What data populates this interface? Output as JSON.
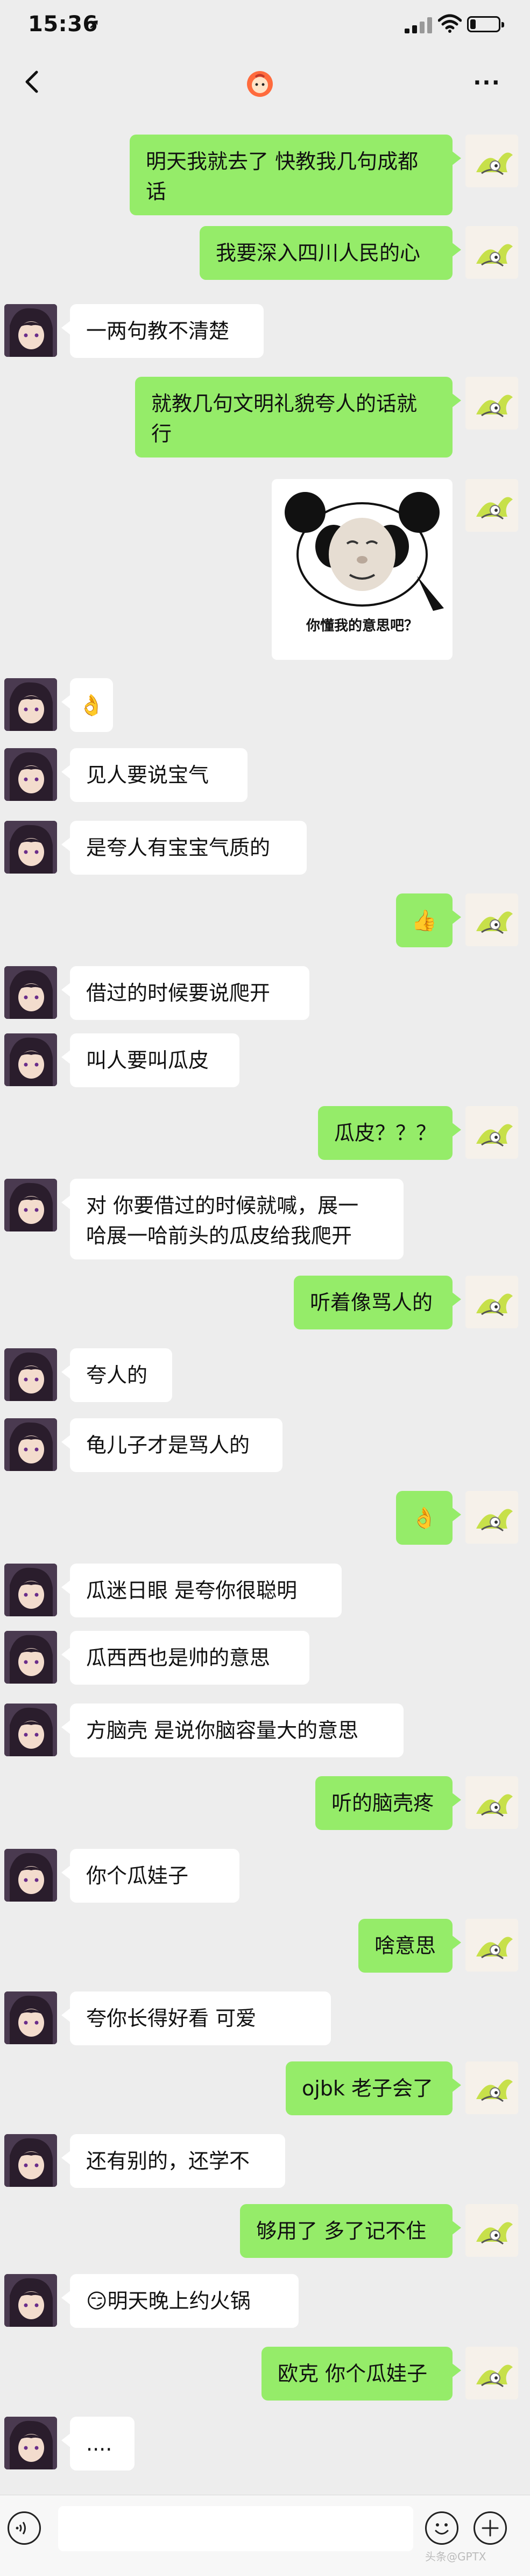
{
  "status_bar": {
    "time": "15:36",
    "location_icon": "location-arrow-icon",
    "signal_icon": "signal-bars-icon",
    "wifi_icon": "wifi-icon",
    "battery_icon": "battery-icon",
    "battery_level": 0.2
  },
  "nav": {
    "back_icon": "chevron-left-icon",
    "title_avatar_icon": "contact-avatar-icon",
    "more_label": "···"
  },
  "messages": [
    {
      "side": "me",
      "type": "text",
      "text": "明天我就去了 快教我几句成都\n话"
    },
    {
      "side": "me",
      "type": "text",
      "text": "我要深入四川人民的心"
    },
    {
      "side": "them",
      "type": "text",
      "text": "一两句教不清楚"
    },
    {
      "side": "me",
      "type": "text",
      "text": "就教几句文明礼貌夸人的话就\n行"
    },
    {
      "side": "me",
      "type": "sticker",
      "text": "你懂我的意思吧？"
    },
    {
      "side": "them",
      "type": "emoji",
      "text": "👌"
    },
    {
      "side": "them",
      "type": "text",
      "text": "见人要说宝气"
    },
    {
      "side": "them",
      "type": "text",
      "text": "是夸人有宝宝气质的"
    },
    {
      "side": "me",
      "type": "emoji",
      "text": "👍"
    },
    {
      "side": "them",
      "type": "text",
      "text": "借过的时候要说爬开"
    },
    {
      "side": "them",
      "type": "text",
      "text": "叫人要叫瓜皮"
    },
    {
      "side": "me",
      "type": "text",
      "text": "瓜皮？？？"
    },
    {
      "side": "them",
      "type": "text",
      "text": "对 你要借过的时候就喊，展一\n哈展一哈前头的瓜皮给我爬开"
    },
    {
      "side": "me",
      "type": "text",
      "text": "听着像骂人的"
    },
    {
      "side": "them",
      "type": "text",
      "text": "夸人的"
    },
    {
      "side": "them",
      "type": "text",
      "text": "龟儿子才是骂人的"
    },
    {
      "side": "me",
      "type": "emoji",
      "text": "👌"
    },
    {
      "side": "them",
      "type": "text",
      "text": "瓜迷日眼 是夸你很聪明"
    },
    {
      "side": "them",
      "type": "text",
      "text": "瓜西西也是帅的意思"
    },
    {
      "side": "them",
      "type": "text",
      "text": "方脑壳 是说你脑容量大的意思"
    },
    {
      "side": "me",
      "type": "text",
      "text": "听的脑壳疼"
    },
    {
      "side": "them",
      "type": "text",
      "text": "你个瓜娃子"
    },
    {
      "side": "me",
      "type": "text",
      "text": "啥意思"
    },
    {
      "side": "them",
      "type": "text",
      "text": "夸你长得好看 可爱"
    },
    {
      "side": "me",
      "type": "text",
      "text": "ojbk 老子会了"
    },
    {
      "side": "them",
      "type": "text",
      "text": "还有别的，还学不"
    },
    {
      "side": "me",
      "type": "text",
      "text": "够用了 多了记不住"
    },
    {
      "side": "them",
      "type": "text",
      "text": "😏明天晚上约火锅"
    },
    {
      "side": "me",
      "type": "text",
      "text": "欧克 你个瓜娃子"
    },
    {
      "side": "them",
      "type": "text",
      "text": "...."
    }
  ],
  "input_bar": {
    "voice_icon": "voice-icon",
    "emoji_icon": "smiley-icon",
    "plus_icon": "plus-icon",
    "watermark": "头条@GPTX"
  }
}
